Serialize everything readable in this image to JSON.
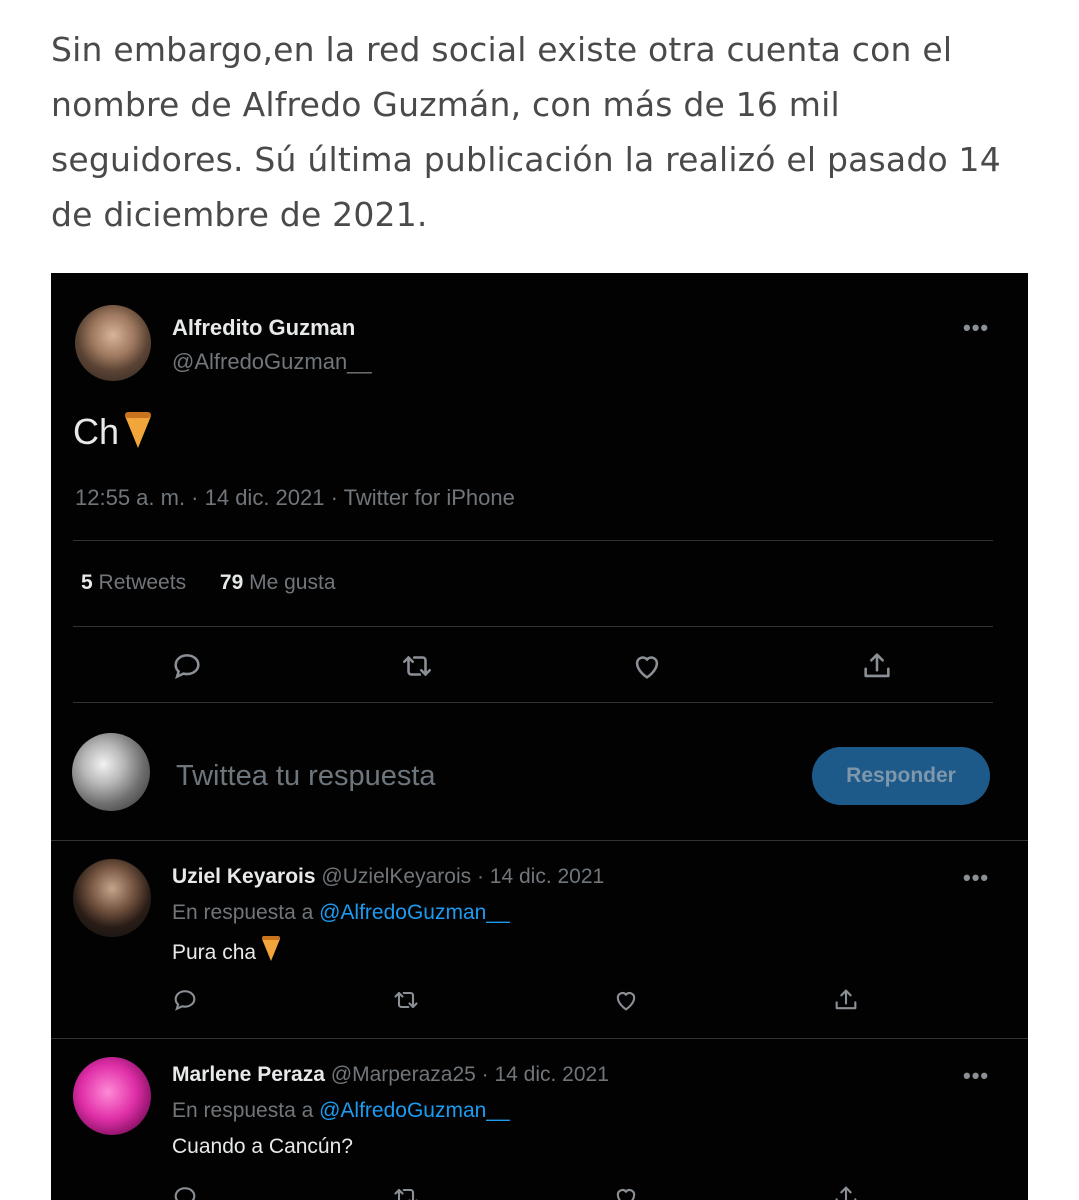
{
  "article": {
    "paragraph": "Sin embargo,en la red social existe otra cuenta con el nombre de Alfredo Guzmán, con más de 16 mil seguidores. Sú última publicación la realizó el pasado 14 de diciembre de 2021."
  },
  "tweet": {
    "author_name": "Alfredito Guzman",
    "author_handle": "@AlfredoGuzman__",
    "more": "•••",
    "text": "Ch",
    "emoji": "pizza",
    "meta": "12:55 a. m. · 14 dic. 2021 · Twitter for iPhone",
    "retweets_count": "5",
    "retweets_label": "Retweets",
    "likes_count": "79",
    "likes_label": "Me gusta"
  },
  "compose": {
    "placeholder": "Twittea tu respuesta",
    "button": "Responder"
  },
  "replies": [
    {
      "name": "Uziel Keyarois",
      "handle_date": "@UzielKeyarois · 14 dic. 2021",
      "in_reply_prefix": "En respuesta a",
      "in_reply_handle": "@AlfredoGuzman__",
      "text": "Pura cha",
      "emoji": "pizza",
      "more": "•••"
    },
    {
      "name": "Marlene Peraza",
      "handle_date": "@Marperaza25 · 14 dic. 2021",
      "in_reply_prefix": "En respuesta a",
      "in_reply_handle": "@AlfredoGuzman__",
      "text": "Cuando a Cancún?",
      "more": "•••"
    }
  ],
  "colors": {
    "background": "#000000",
    "text_primary": "#e7e9ea",
    "text_secondary": "#71767b",
    "link": "#1d9bf0",
    "button": "#1d5a8a"
  },
  "icons": [
    "reply-icon",
    "retweet-icon",
    "like-icon",
    "share-icon",
    "more-icon",
    "pizza-emoji"
  ]
}
